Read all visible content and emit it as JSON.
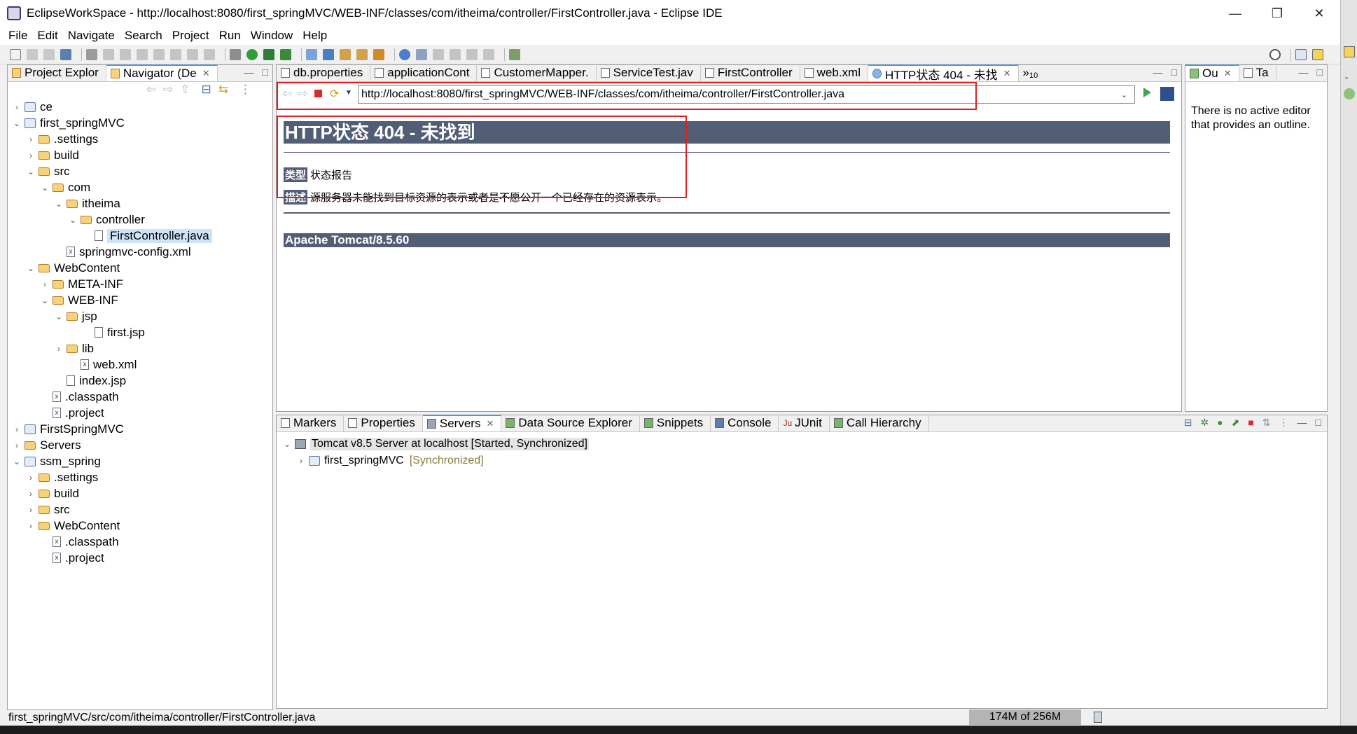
{
  "window": {
    "title": "EclipseWorkSpace - http://localhost:8080/first_springMVC/WEB-INF/classes/com/itheima/controller/FirstController.java - Eclipse IDE",
    "minimize": "—",
    "restore": "❐",
    "close": "✕"
  },
  "menu": [
    "File",
    "Edit",
    "Navigate",
    "Search",
    "Project",
    "Run",
    "Window",
    "Help"
  ],
  "left_panel": {
    "tabs": [
      {
        "label": "Project Explor"
      },
      {
        "label": "Navigator (De"
      }
    ],
    "tree": [
      {
        "label": "ce",
        "depth": 0,
        "arrow": "›",
        "kind": "project"
      },
      {
        "label": "first_springMVC",
        "depth": 0,
        "arrow": "⌄",
        "kind": "project"
      },
      {
        "label": ".settings",
        "depth": 1,
        "arrow": "›",
        "kind": "folder"
      },
      {
        "label": "build",
        "depth": 1,
        "arrow": "›",
        "kind": "folder"
      },
      {
        "label": "src",
        "depth": 1,
        "arrow": "⌄",
        "kind": "folder"
      },
      {
        "label": "com",
        "depth": 2,
        "arrow": "⌄",
        "kind": "folder"
      },
      {
        "label": "itheima",
        "depth": 3,
        "arrow": "⌄",
        "kind": "folder"
      },
      {
        "label": "controller",
        "depth": 4,
        "arrow": "⌄",
        "kind": "folder"
      },
      {
        "label": "FirstController.java",
        "depth": 5,
        "arrow": "",
        "kind": "file",
        "selected": true
      },
      {
        "label": "springmvc-config.xml",
        "depth": 3,
        "arrow": "",
        "kind": "xml"
      },
      {
        "label": "WebContent",
        "depth": 1,
        "arrow": "⌄",
        "kind": "folder"
      },
      {
        "label": "META-INF",
        "depth": 2,
        "arrow": "›",
        "kind": "folder"
      },
      {
        "label": "WEB-INF",
        "depth": 2,
        "arrow": "⌄",
        "kind": "folder"
      },
      {
        "label": "jsp",
        "depth": 3,
        "arrow": "⌄",
        "kind": "folder"
      },
      {
        "label": "first.jsp",
        "depth": 5,
        "arrow": "",
        "kind": "file"
      },
      {
        "label": "lib",
        "depth": 3,
        "arrow": "›",
        "kind": "folder"
      },
      {
        "label": "web.xml",
        "depth": 4,
        "arrow": "",
        "kind": "xml"
      },
      {
        "label": "index.jsp",
        "depth": 3,
        "arrow": "",
        "kind": "file"
      },
      {
        "label": ".classpath",
        "depth": 2,
        "arrow": "",
        "kind": "xml"
      },
      {
        "label": ".project",
        "depth": 2,
        "arrow": "",
        "kind": "xml"
      },
      {
        "label": "FirstSpringMVC",
        "depth": 0,
        "arrow": "›",
        "kind": "project"
      },
      {
        "label": "Servers",
        "depth": 0,
        "arrow": "›",
        "kind": "folder"
      },
      {
        "label": "ssm_spring",
        "depth": 0,
        "arrow": "⌄",
        "kind": "project"
      },
      {
        "label": ".settings",
        "depth": 1,
        "arrow": "›",
        "kind": "folder"
      },
      {
        "label": "build",
        "depth": 1,
        "arrow": "›",
        "kind": "folder"
      },
      {
        "label": "src",
        "depth": 1,
        "arrow": "›",
        "kind": "folder"
      },
      {
        "label": "WebContent",
        "depth": 1,
        "arrow": "›",
        "kind": "folder"
      },
      {
        "label": ".classpath",
        "depth": 2,
        "arrow": "",
        "kind": "xml"
      },
      {
        "label": ".project",
        "depth": 2,
        "arrow": "",
        "kind": "xml"
      }
    ]
  },
  "editor": {
    "tabs": [
      {
        "label": "db.properties"
      },
      {
        "label": "applicationCont"
      },
      {
        "label": "CustomerMapper."
      },
      {
        "label": "ServiceTest.jav"
      },
      {
        "label": "FirstController"
      },
      {
        "label": "web.xml"
      },
      {
        "label": "HTTP状态 404 - 未找",
        "active": true
      }
    ],
    "overflow": "»",
    "overflow_count": "10",
    "url": "http://localhost:8080/first_springMVC/WEB-INF/classes/com/itheima/controller/FirstController.java",
    "page": {
      "heading": "HTTP状态 404 - 未找到",
      "type_label": "类型",
      "type_value": "状态报告",
      "desc_label": "描述",
      "desc_value": "源服务器未能找到目标资源的表示或者是不愿公开一个已经存在的资源表示。",
      "footer": "Apache Tomcat/8.5.60"
    }
  },
  "outline": {
    "tabs": [
      {
        "label": "Ou"
      },
      {
        "label": "Ta"
      }
    ],
    "message": "There is no active editor that provides an outline."
  },
  "bottom_panel": {
    "tabs": [
      {
        "label": "Markers"
      },
      {
        "label": "Properties"
      },
      {
        "label": "Servers",
        "active": true
      },
      {
        "label": "Data Source Explorer"
      },
      {
        "label": "Snippets"
      },
      {
        "label": "Console"
      },
      {
        "label": "JUnit"
      },
      {
        "label": "Call Hierarchy"
      }
    ],
    "server": "Tomcat v8.5 Server at localhost  [Started, Synchronized]",
    "module": "first_springMVC",
    "module_state": "[Synchronized]"
  },
  "status": {
    "path": "first_springMVC/src/com/itheima/controller/FirstController.java",
    "heap": "174M of 256M"
  },
  "colors": {
    "tomcat_header": "#525d76",
    "highlight_box": "#e02020",
    "selection": "#cfe3f8"
  }
}
